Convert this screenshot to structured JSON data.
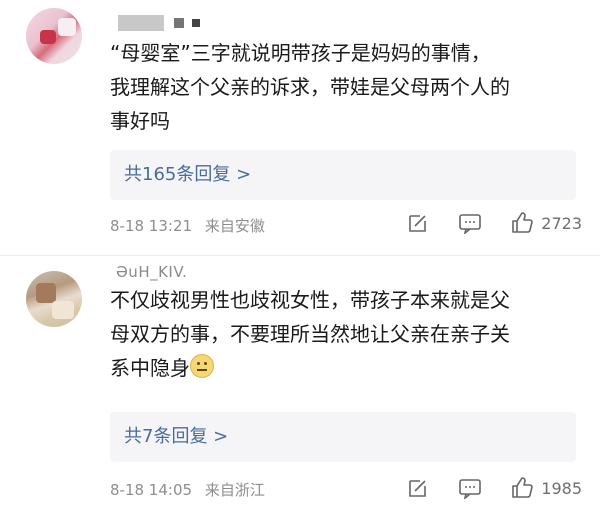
{
  "comments": [
    {
      "content_lines": [
        "“母婴室”三字就说明带孩子是妈妈的事情，",
        "我理解这个父亲的诉求，带娃是父母两个人的",
        "事好吗"
      ],
      "replies_label": "共165条回复 >",
      "time": "8-18 13:21",
      "location": "来自安徽",
      "likes": "2723"
    },
    {
      "username_fragment": "ƏuH_KIV.",
      "content_lines": [
        "不仅歧视男性也歧视女性，带孩子本来就是父",
        "母双方的事，不要理所当然地让父亲在亲子关",
        "系中隐身"
      ],
      "replies_label": "共7条回复 >",
      "time": "8-18 14:05",
      "location": "来自浙江",
      "likes": "1985"
    }
  ],
  "icons": {
    "share": "share-edit-icon",
    "comment": "comment-icon",
    "like": "thumbs-up-icon",
    "emoji": "smile-emoji-icon"
  },
  "colors": {
    "reply_link": "#4a6c9b",
    "meta_text": "#8e8e8e",
    "reply_bg": "#f5f5f7"
  }
}
